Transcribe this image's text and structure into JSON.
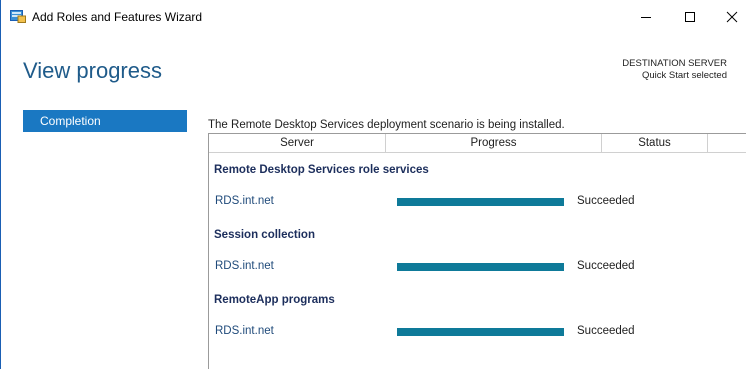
{
  "window": {
    "title": "Add Roles and Features Wizard",
    "icon": "server-manager-icon"
  },
  "caption_buttons": {
    "minimize": "minimize-icon",
    "maximize": "maximize-icon",
    "close": "close-icon"
  },
  "header": {
    "page_title": "View progress",
    "destination_label": "DESTINATION SERVER",
    "destination_value": "Quick Start selected"
  },
  "nav": {
    "items": [
      {
        "label": "Completion",
        "selected": true
      }
    ]
  },
  "main": {
    "intro": "The Remote Desktop Services deployment scenario is being installed.",
    "columns": {
      "server": "Server",
      "progress": "Progress",
      "status": "Status"
    },
    "groups": [
      {
        "title": "Remote Desktop Services role services",
        "rows": [
          {
            "server": "RDS.int.net",
            "progress": 1.0,
            "status": "Succeeded"
          }
        ]
      },
      {
        "title": "Session collection",
        "rows": [
          {
            "server": "RDS.int.net",
            "progress": 1.0,
            "status": "Succeeded"
          }
        ]
      },
      {
        "title": "RemoteApp programs",
        "rows": [
          {
            "server": "RDS.int.net",
            "progress": 1.0,
            "status": "Succeeded"
          }
        ]
      }
    ]
  },
  "colors": {
    "accent": "#1a78c2",
    "title_blue": "#1f5b8a",
    "progress_fill": "#0e7a99",
    "group_title": "#1c2e5c"
  }
}
